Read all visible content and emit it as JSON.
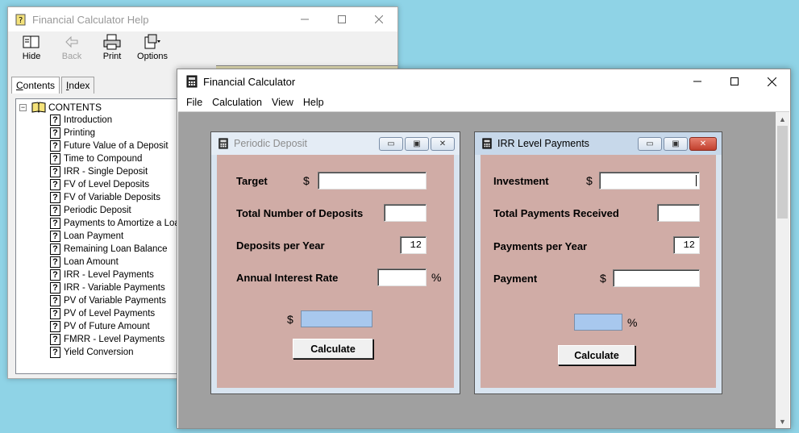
{
  "help_window": {
    "title": "Financial Calculator Help",
    "toolbar": [
      {
        "label": "Hide",
        "icon": "hide-icon",
        "enabled": true
      },
      {
        "label": "Back",
        "icon": "back-arrow-icon",
        "enabled": false
      },
      {
        "label": "Print",
        "icon": "printer-icon",
        "enabled": true
      },
      {
        "label": "Options",
        "icon": "options-icon",
        "enabled": true
      }
    ],
    "tabs": [
      {
        "label_u": "C",
        "label_rest": "ontents"
      },
      {
        "label_u": "I",
        "label_rest": "ndex"
      }
    ],
    "tree_root": "CONTENTS",
    "tree_items": [
      "Introduction",
      "Printing",
      "Future Value of a Deposit",
      "Time to Compound",
      "IRR - Single Deposit",
      "FV of Level Deposits",
      "FV of Variable Deposits",
      "Periodic Deposit",
      "Payments to Amortize a Loan",
      "Loan Payment",
      "Remaining Loan Balance",
      "Loan Amount",
      "IRR - Level Payments",
      "IRR - Variable Payments",
      "PV of Variable Payments",
      "PV of Level Payments",
      "PV of Future Amount",
      "FMRR - Level Payments",
      "Yield Conversion"
    ]
  },
  "calc_window": {
    "title": "Financial Calculator",
    "menu": [
      "File",
      "Calculation",
      "View",
      "Help"
    ]
  },
  "periodic_deposit": {
    "title": "Periodic Deposit",
    "target_label": "Target",
    "target_symbol": "$",
    "target_value": "",
    "num_deposits_label": "Total Number of Deposits",
    "num_deposits_value": "",
    "per_year_label": "Deposits per Year",
    "per_year_value": "12",
    "rate_label": "Annual Interest Rate",
    "rate_value": "",
    "rate_symbol": "%",
    "result_symbol": "$",
    "calculate_label": "Calculate"
  },
  "irr_level": {
    "title": "IRR Level Payments",
    "investment_label": "Investment",
    "investment_symbol": "$",
    "investment_value": "",
    "total_received_label": "Total Payments Received",
    "total_received_value": "",
    "per_year_label": "Payments per Year",
    "per_year_value": "12",
    "payment_label": "Payment",
    "payment_symbol": "$",
    "payment_value": "",
    "result_symbol": "%",
    "calculate_label": "Calculate"
  }
}
